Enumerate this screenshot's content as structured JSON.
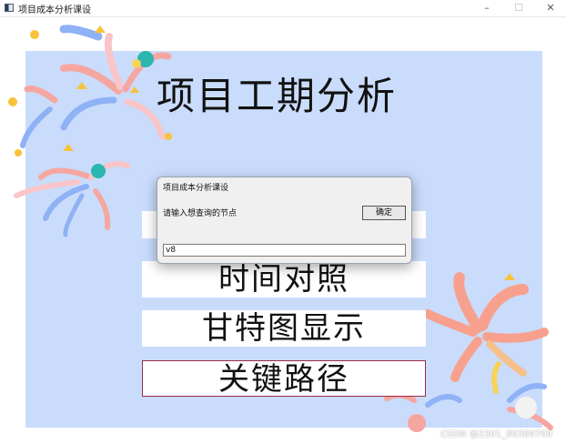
{
  "window": {
    "title": "项目成本分析课设",
    "min_glyph": "–",
    "max_glyph": "☐",
    "close_glyph": "✕"
  },
  "main": {
    "title": "项目工期分析",
    "buttons": [
      {
        "label": ""
      },
      {
        "label": "时间对照"
      },
      {
        "label": "甘特图显示"
      },
      {
        "label": "关键路径"
      }
    ]
  },
  "dialog": {
    "title": "项目成本分析课设",
    "prompt": "请输入想查询的节点",
    "ok_label": "确定",
    "input_value": "v8"
  },
  "watermark": "CSDN @2301_80389709",
  "colors": {
    "panel": "#c9dcfb",
    "button": "#ffffff",
    "selected_border": "#9b2a4b"
  }
}
